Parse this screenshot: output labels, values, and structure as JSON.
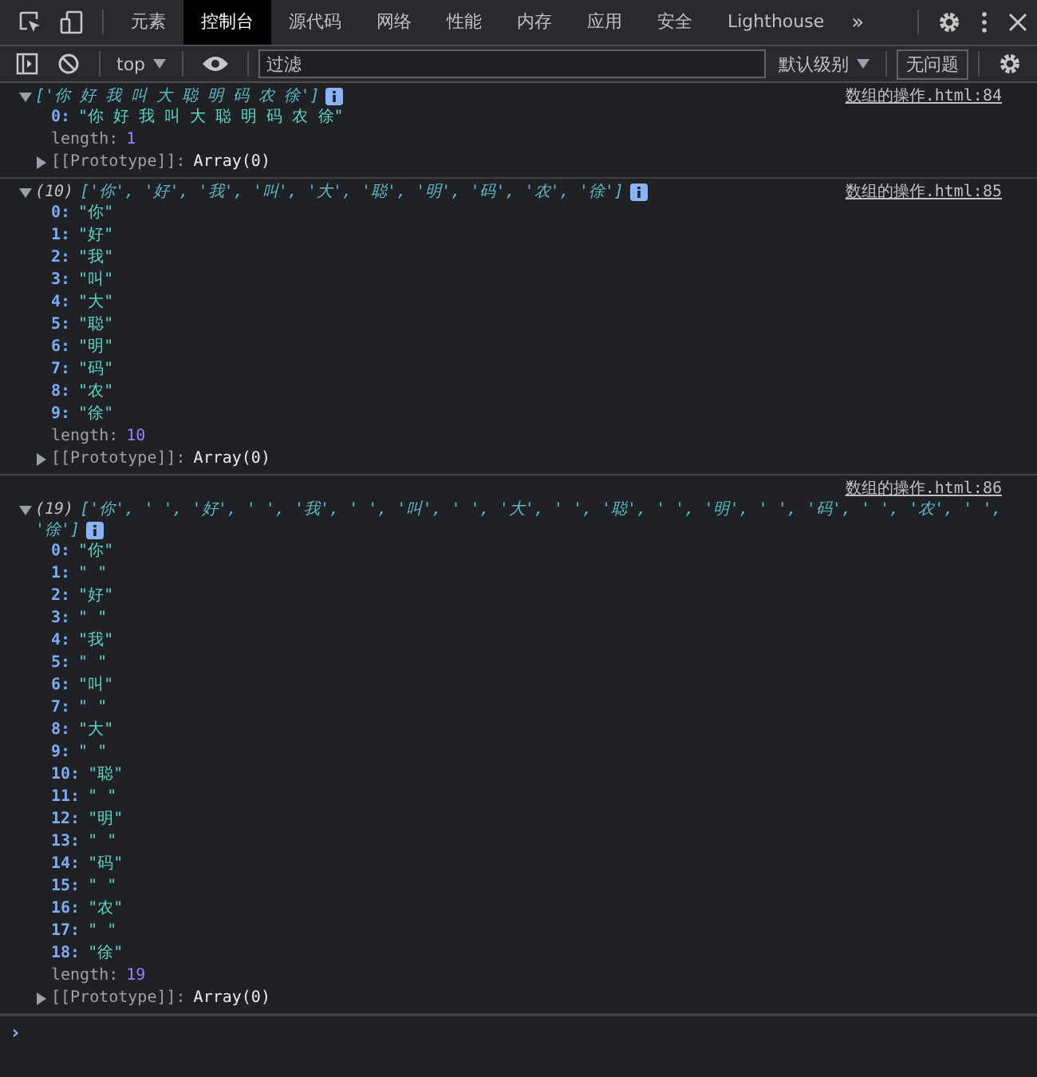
{
  "tabs": [
    {
      "label": "元素",
      "selected": false
    },
    {
      "label": "控制台",
      "selected": true
    },
    {
      "label": "源代码",
      "selected": false
    },
    {
      "label": "网络",
      "selected": false
    },
    {
      "label": "性能",
      "selected": false
    },
    {
      "label": "内存",
      "selected": false
    },
    {
      "label": "应用",
      "selected": false
    },
    {
      "label": "安全",
      "selected": false
    },
    {
      "label": "Lighthouse",
      "selected": false
    }
  ],
  "more_tabs": "»",
  "toolbar": {
    "context": "top",
    "filter_placeholder": "过滤",
    "level": "默认级别",
    "issues": "无问题"
  },
  "logs": [
    {
      "source": "数组的操作.html:84",
      "preview_lines": [
        "['你 好 我 叫 大 聪 明 码 农 徐']"
      ],
      "expanded": true,
      "properties": [
        {
          "key": "0:",
          "value": "\"你 好 我 叫 大 聪 明 码 农 徐\"",
          "kind": "string"
        },
        {
          "key": "length:",
          "value": "1",
          "kind": "number"
        }
      ],
      "prototype": {
        "label": "[[Prototype]]:",
        "value": "Array(0)",
        "expanded": false
      }
    },
    {
      "source": "数组的操作.html:85",
      "count": "(10)",
      "preview_lines": [
        "['你', '好', '我', '叫', '大', '聪', '明', '码', '农', '徐']"
      ],
      "expanded": true,
      "properties": [
        {
          "key": "0:",
          "value": "\"你\"",
          "kind": "string"
        },
        {
          "key": "1:",
          "value": "\"好\"",
          "kind": "string"
        },
        {
          "key": "2:",
          "value": "\"我\"",
          "kind": "string"
        },
        {
          "key": "3:",
          "value": "\"叫\"",
          "kind": "string"
        },
        {
          "key": "4:",
          "value": "\"大\"",
          "kind": "string"
        },
        {
          "key": "5:",
          "value": "\"聪\"",
          "kind": "string"
        },
        {
          "key": "6:",
          "value": "\"明\"",
          "kind": "string"
        },
        {
          "key": "7:",
          "value": "\"码\"",
          "kind": "string"
        },
        {
          "key": "8:",
          "value": "\"农\"",
          "kind": "string"
        },
        {
          "key": "9:",
          "value": "\"徐\"",
          "kind": "string"
        },
        {
          "key": "length:",
          "value": "10",
          "kind": "number"
        }
      ],
      "prototype": {
        "label": "[[Prototype]]:",
        "value": "Array(0)",
        "expanded": false
      }
    },
    {
      "source": "数组的操作.html:86",
      "count": "(19)",
      "preview_lines": [
        "['你', ' ', '好', ' ', '我', ' ', '叫', ' ', '大', ' ', '聪', ' ', '明', ' ', '码', ' ', '农', ' ',",
        "'徐']"
      ],
      "expanded": true,
      "properties": [
        {
          "key": "0:",
          "value": "\"你\"",
          "kind": "string"
        },
        {
          "key": "1:",
          "value": "\" \"",
          "kind": "string"
        },
        {
          "key": "2:",
          "value": "\"好\"",
          "kind": "string"
        },
        {
          "key": "3:",
          "value": "\" \"",
          "kind": "string"
        },
        {
          "key": "4:",
          "value": "\"我\"",
          "kind": "string"
        },
        {
          "key": "5:",
          "value": "\" \"",
          "kind": "string"
        },
        {
          "key": "6:",
          "value": "\"叫\"",
          "kind": "string"
        },
        {
          "key": "7:",
          "value": "\" \"",
          "kind": "string"
        },
        {
          "key": "8:",
          "value": "\"大\"",
          "kind": "string"
        },
        {
          "key": "9:",
          "value": "\" \"",
          "kind": "string"
        },
        {
          "key": "10:",
          "value": "\"聪\"",
          "kind": "string"
        },
        {
          "key": "11:",
          "value": "\" \"",
          "kind": "string"
        },
        {
          "key": "12:",
          "value": "\"明\"",
          "kind": "string"
        },
        {
          "key": "13:",
          "value": "\" \"",
          "kind": "string"
        },
        {
          "key": "14:",
          "value": "\"码\"",
          "kind": "string"
        },
        {
          "key": "15:",
          "value": "\" \"",
          "kind": "string"
        },
        {
          "key": "16:",
          "value": "\"农\"",
          "kind": "string"
        },
        {
          "key": "17:",
          "value": "\" \"",
          "kind": "string"
        },
        {
          "key": "18:",
          "value": "\"徐\"",
          "kind": "string"
        },
        {
          "key": "length:",
          "value": "19",
          "kind": "number"
        }
      ],
      "prototype": {
        "label": "[[Prototype]]:",
        "value": "Array(0)",
        "expanded": false
      }
    }
  ],
  "prompt": "›"
}
